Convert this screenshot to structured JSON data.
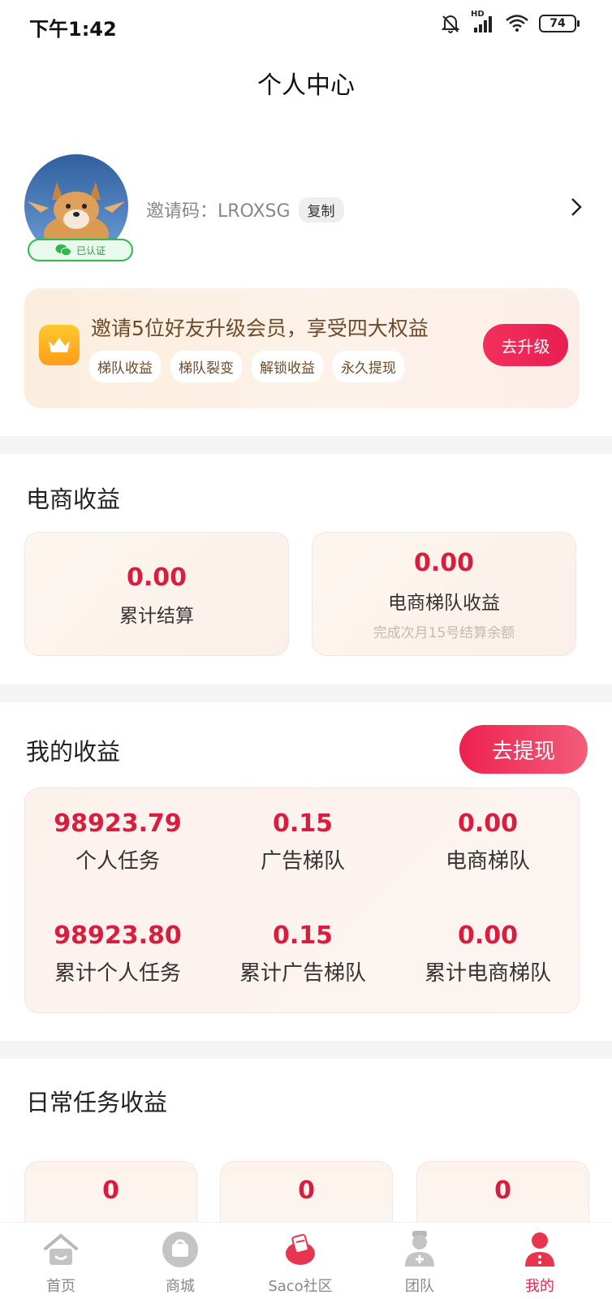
{
  "status_bar": {
    "time": "下午1:42",
    "network_label": "HD",
    "battery": "74"
  },
  "page_title": "个人中心",
  "profile": {
    "verified_label": "已认证",
    "invite_label": "邀请码：LROXSG",
    "copy_label": "复制"
  },
  "upgrade": {
    "title": "邀请5位好友升级会员，享受四大权益",
    "perks": [
      "梯队收益",
      "梯队裂变",
      "解锁收益",
      "永久提现"
    ],
    "button": "去升级"
  },
  "ecommerce": {
    "title": "电商收益",
    "cards": [
      {
        "value": "0.00",
        "label": "累计结算",
        "note": ""
      },
      {
        "value": "0.00",
        "label": "电商梯队收益",
        "note": "完成次月15号结算余额"
      }
    ]
  },
  "my_earnings": {
    "title": "我的收益",
    "withdraw_button": "去提现",
    "items": [
      {
        "value": "98923.79",
        "label": "个人任务"
      },
      {
        "value": "0.15",
        "label": "广告梯队"
      },
      {
        "value": "0.00",
        "label": "电商梯队"
      },
      {
        "value": "98923.80",
        "label": "累计个人任务"
      },
      {
        "value": "0.15",
        "label": "累计广告梯队"
      },
      {
        "value": "0.00",
        "label": "累计电商梯队"
      }
    ]
  },
  "daily": {
    "title": "日常任务收益",
    "values": [
      "0",
      "0",
      "0"
    ]
  },
  "tabbar": {
    "items": [
      {
        "label": "首页",
        "icon": "home-icon"
      },
      {
        "label": "商城",
        "icon": "shop-icon"
      },
      {
        "label": "Saco社区",
        "icon": "community-icon"
      },
      {
        "label": "团队",
        "icon": "team-icon"
      },
      {
        "label": "我的",
        "icon": "profile-icon"
      }
    ],
    "active_index": 4
  },
  "colors": {
    "accent_red": "#d81e3f",
    "button_red": "#e81e52",
    "verified_green": "#2fb84c",
    "card_cream": "#fbeedd"
  }
}
